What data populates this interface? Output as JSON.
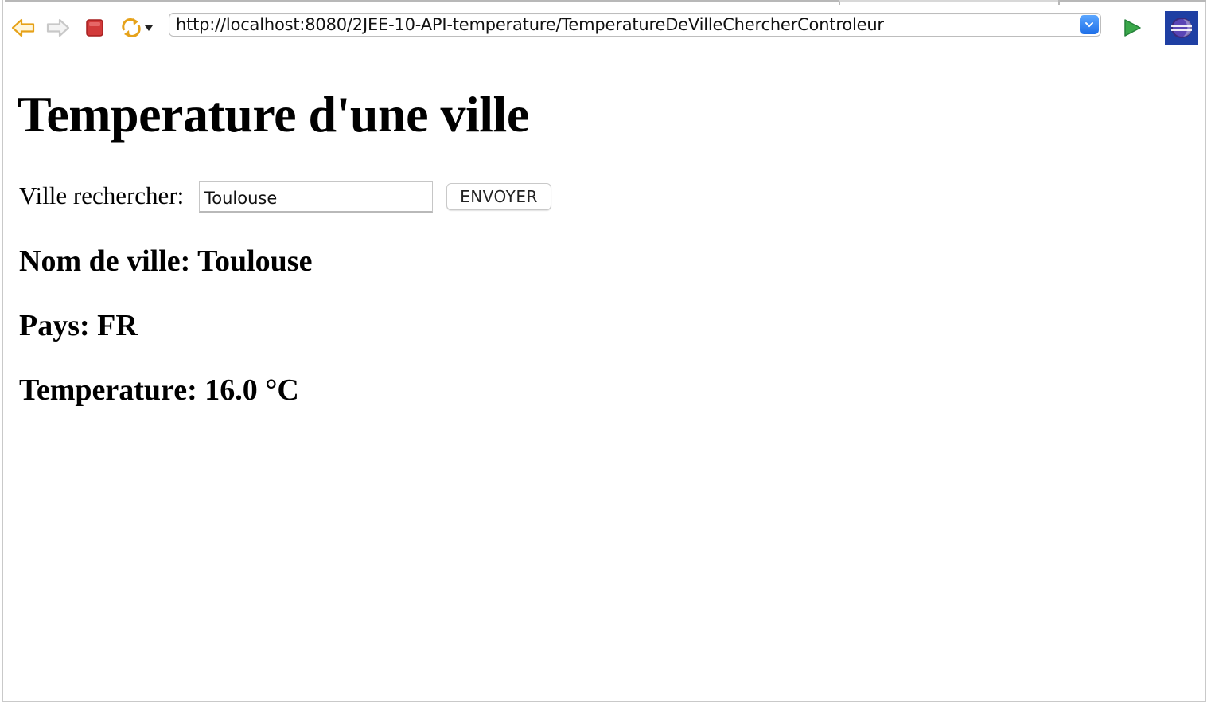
{
  "browser": {
    "url": "http://localhost:8080/2JEE-10-API-temperature/TemperatureDeVilleChercherControleur",
    "icons": {
      "back": "back-arrow-icon",
      "forward": "forward-arrow-icon",
      "stop": "stop-icon",
      "refresh": "refresh-icon",
      "refresh_menu": "chevron-down-icon",
      "url_dropdown": "chevron-down-icon",
      "go": "go-play-icon",
      "eclipse": "eclipse-logo-icon"
    },
    "colors": {
      "back_arrow": "#e6a21a",
      "forward_arrow": "#c8c8c8",
      "stop": "#d23a3a",
      "refresh": "#e6a21a",
      "go": "#3aa84a",
      "url_dropdown": "#2f7bef"
    }
  },
  "page": {
    "title": "Temperature d'une ville",
    "search": {
      "label": "Ville rechercher:",
      "value": "Toulouse",
      "button_label": "ENVOYER"
    },
    "results": {
      "city_label": "Nom de ville:",
      "city_value": "Toulouse",
      "country_label": "Pays:",
      "country_value": "FR",
      "temperature_label": "Temperature:",
      "temperature_value": "16.0 °C"
    }
  }
}
